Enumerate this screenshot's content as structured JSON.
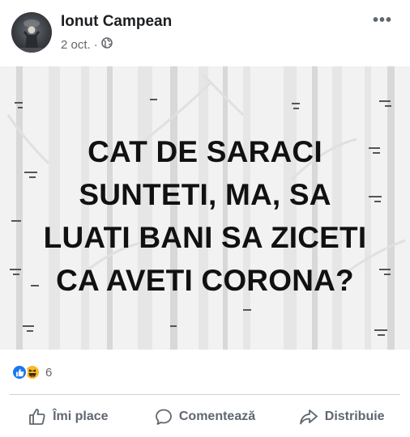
{
  "post": {
    "author": "Ionut Campean",
    "date": "2 oct.",
    "separator": "·",
    "privacy_icon": "globe-icon",
    "more_icon": "more-options-icon"
  },
  "image": {
    "lines": [
      "CAT DE SARACI",
      "SUNTETI, MA, SA",
      "LUATI BANI SA ZICETI",
      "CA AVETI CORONA?"
    ]
  },
  "reactions": {
    "icons": [
      "like-reaction-icon",
      "haha-reaction-icon"
    ],
    "count": "6"
  },
  "actions": {
    "like_label": "Îmi place",
    "comment_label": "Comentează",
    "share_label": "Distribuie"
  },
  "colors": {
    "like_blue": "#1877f2",
    "haha_yellow": "#f7b928",
    "secondary_text": "#65676b"
  }
}
